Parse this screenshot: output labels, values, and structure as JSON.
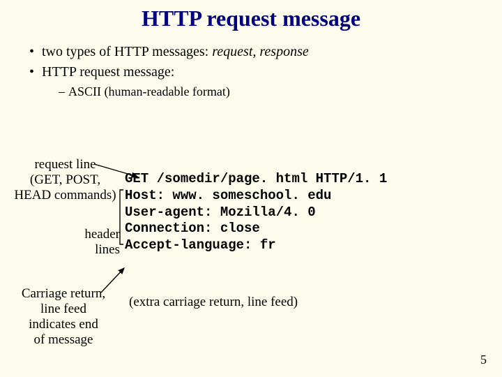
{
  "title": "HTTP request message",
  "bullets": {
    "b1_pre": "two types of HTTP messages: ",
    "b1_emph": "request, response",
    "b2": "HTTP request message:",
    "sub": "ASCII (human-readable format)"
  },
  "labels": {
    "request_line": "request line\n(GET, POST,\nHEAD commands)",
    "header_lines": "header\nlines",
    "carriage": "Carriage return,\nline feed\nindicates end\nof message",
    "extra": "(extra carriage return, line feed)"
  },
  "http": {
    "l1": "GET /somedir/page. html HTTP/1. 1",
    "l2": "Host: www. someschool. edu",
    "l3": "User-agent: Mozilla/4. 0",
    "l4": "Connection: close",
    "l5": "Accept-language: fr"
  },
  "page_number": "5"
}
